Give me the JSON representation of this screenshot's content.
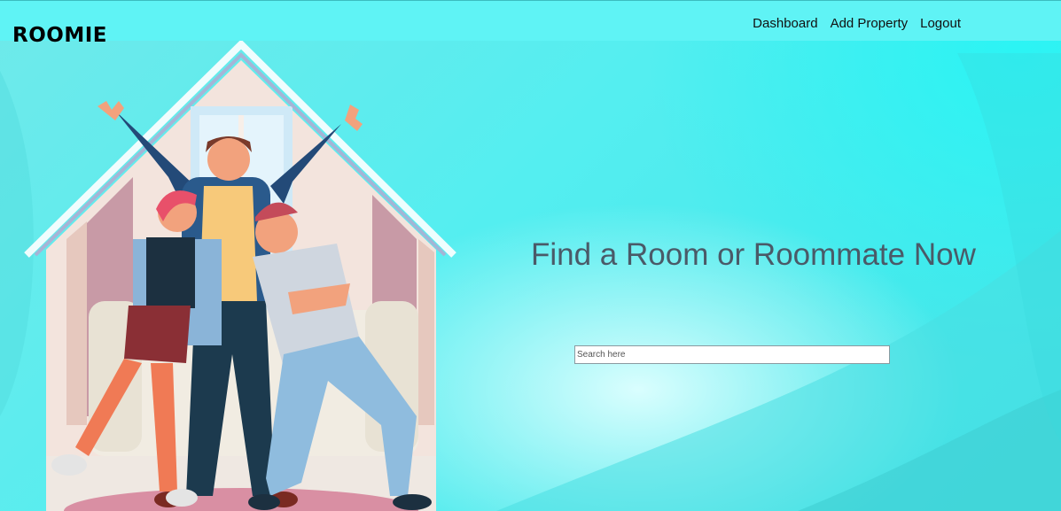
{
  "brand": {
    "name": "ROOMIE"
  },
  "nav": {
    "items": [
      {
        "label": "Dashboard"
      },
      {
        "label": "Add Property"
      },
      {
        "label": "Logout"
      }
    ]
  },
  "hero": {
    "title": "Find a Room or Roommate Now",
    "illustration": "three-friends-in-house-illustration"
  },
  "search": {
    "placeholder": "Search here",
    "value": ""
  },
  "colors": {
    "navbar": "#5ff3f5",
    "background": "#54eef0",
    "title": "#4a5a68"
  }
}
